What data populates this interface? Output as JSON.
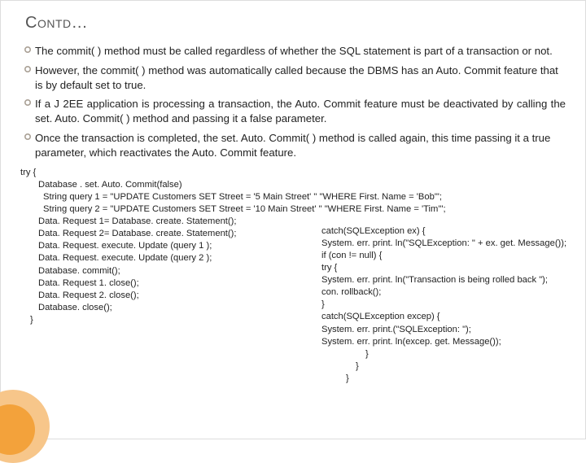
{
  "title": "Contd…",
  "bullets": [
    "The commit( ) method must be called regardless of whether the SQL statement is part of a transaction or not.",
    "However, the commit( ) method was automatically called because the DBMS has an Auto. Commit feature that is by default set to true.",
    "If a J 2EE application is processing a transaction, the Auto. Commit feature must be deactivated by calling the set. Auto. Commit( ) method and passing it a false parameter.",
    "Once the transaction is completed, the set. Auto. Commit( ) method is called again, this time passing it a true parameter, which reactivates the Auto. Commit feature."
  ],
  "code": {
    "l0": "try {",
    "l1": "Database . set. Auto. Commit(false)",
    "l2": "String query 1 = \"UPDATE Customers SET Street = '5 Main Street' \" \"WHERE First. Name = 'Bob'\";",
    "l3": "String query 2 = \"UPDATE Customers SET Street = '10 Main Street' \" \"WHERE First. Name = 'Tim'\";",
    "l4": "Data. Request 1= Database. create. Statement();",
    "l5": "Data. Request 2= Database. create. Statement();",
    "l6": "Data. Request. execute. Update (query 1 );",
    "l7": "Data. Request. execute. Update (query 2 );",
    "l8": "Database. commit();",
    "l9": "Data. Request 1. close();",
    "l10": "Data. Request 2. close();",
    "l11": " Database. close();",
    "l12": "}"
  },
  "code_right": {
    "r0": "catch(SQLException  ex) {",
    "r1": "System. err. print. ln(\"SQLException: \" + ex. get. Message());",
    "r2": "if (con != null) {",
    "r3": "try  {",
    "r4": "System. err. print. ln(\"Transaction is being rolled back \");",
    "r5": "con. rollback();",
    "r6": "}",
    "r7": "catch(SQLException excep)    {",
    "r8": "System. err. print.(\"SQLException: \");",
    "r9": "System. err. print. ln(excep. get. Message());",
    "r10": "}",
    "r11": "}",
    "r12": "}"
  }
}
